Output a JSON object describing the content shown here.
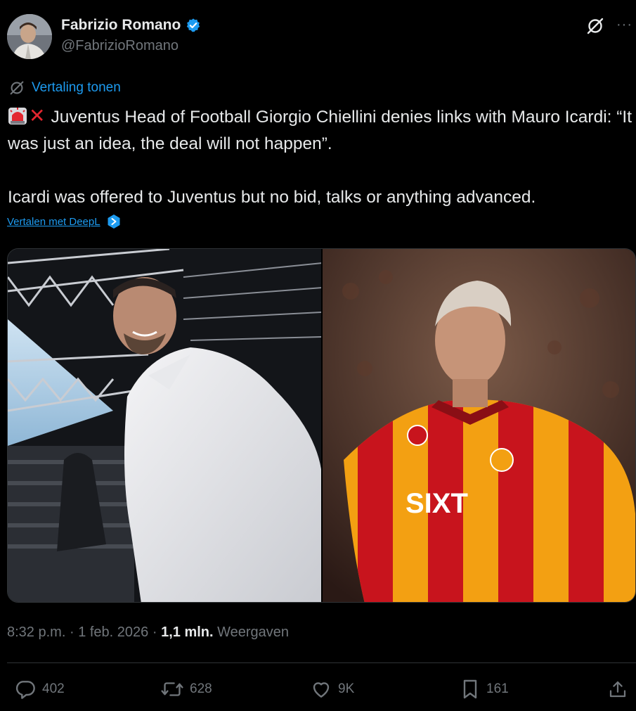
{
  "author": {
    "display_name": "Fabrizio Romano",
    "handle": "@FabrizioRomano",
    "verified": true
  },
  "translate": {
    "label": "Vertaling tonen"
  },
  "tweet": {
    "line1": "Juventus Head of Football Giorgio Chiellini denies links with Mauro Icardi: “It was just an idea, the deal will not happen”.",
    "line2": "Icardi was offered to Juventus but no bid, talks or anything advanced.",
    "emojis": [
      "police-car-light-emoji",
      "cross-mark-emoji"
    ]
  },
  "deepl": {
    "label": "Vertalen met DeepL"
  },
  "media": {
    "images": [
      "photo-chiellini",
      "photo-icardi"
    ],
    "sponsor_text": "SIXT"
  },
  "meta": {
    "time": "8:32 p.m.",
    "separator": "·",
    "date": "1 feb. 2026",
    "views_count": "1,1 mln.",
    "views_label": "Weergaven"
  },
  "actions": {
    "replies": "402",
    "reposts": "628",
    "likes": "9K",
    "bookmarks": "161"
  },
  "colors": {
    "background": "#000000",
    "text": "#e7e9ea",
    "muted": "#71767b",
    "accent": "#1d9bf0",
    "divider": "#2f3336"
  }
}
